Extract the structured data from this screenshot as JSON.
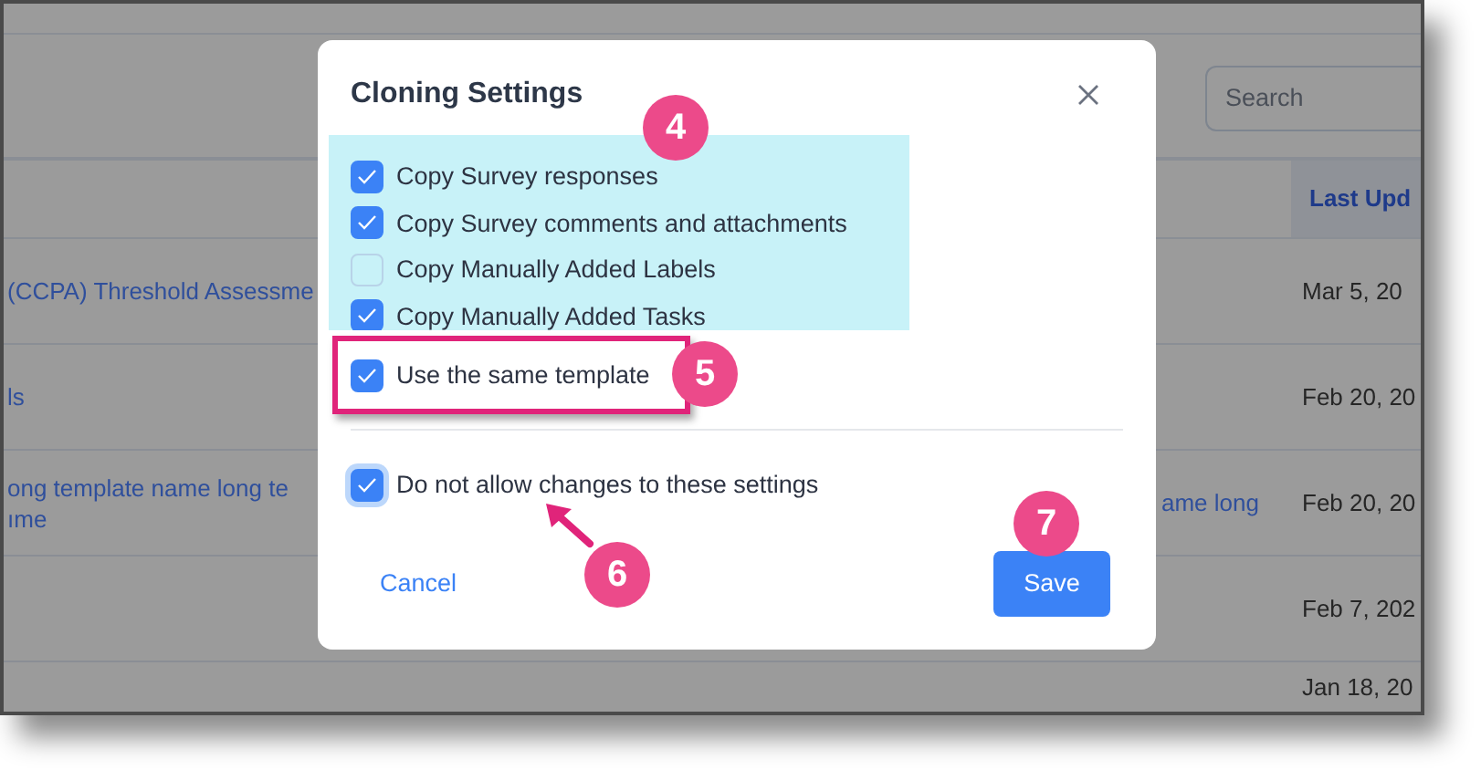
{
  "page": {
    "search": {
      "placeholder": "Search"
    },
    "table": {
      "columns": [
        {
          "label": "Last Upd"
        }
      ],
      "rows": [
        {
          "name": [
            "(CCPA) Threshold Assessme"
          ],
          "name_tail": "",
          "date": "Mar 5, 20"
        },
        {
          "name": [
            "ls"
          ],
          "name_tail": "",
          "date": "Feb 20, 20"
        },
        {
          "name": [
            "ong template name long te",
            "ıme"
          ],
          "name_tail": "ame long",
          "date": "Feb 20, 20"
        },
        {
          "name": [],
          "name_tail": "",
          "date": "Feb 7, 202"
        },
        {
          "name": [],
          "name_tail": "",
          "date": "Jan 18, 20"
        }
      ]
    }
  },
  "dialog": {
    "title": "Cloning Settings",
    "highlighted_options": [
      {
        "label": "Copy Survey responses",
        "checked": true
      },
      {
        "label": "Copy Survey comments and attachments",
        "checked": true
      },
      {
        "label": "Copy Manually Added Labels",
        "checked": false
      },
      {
        "label": "Copy Manually Added Tasks",
        "checked": true
      }
    ],
    "framed_option": {
      "label": "Use the same template",
      "checked": true
    },
    "lock_option": {
      "label": "Do not allow changes to these settings",
      "checked": true,
      "focused": true
    },
    "cancel": "Cancel",
    "save": "Save"
  },
  "markers": [
    {
      "label": "4",
      "arrow": false
    },
    {
      "label": "5",
      "arrow": false
    },
    {
      "label": "6",
      "arrow": true
    },
    {
      "label": "7",
      "arrow": false
    }
  ]
}
